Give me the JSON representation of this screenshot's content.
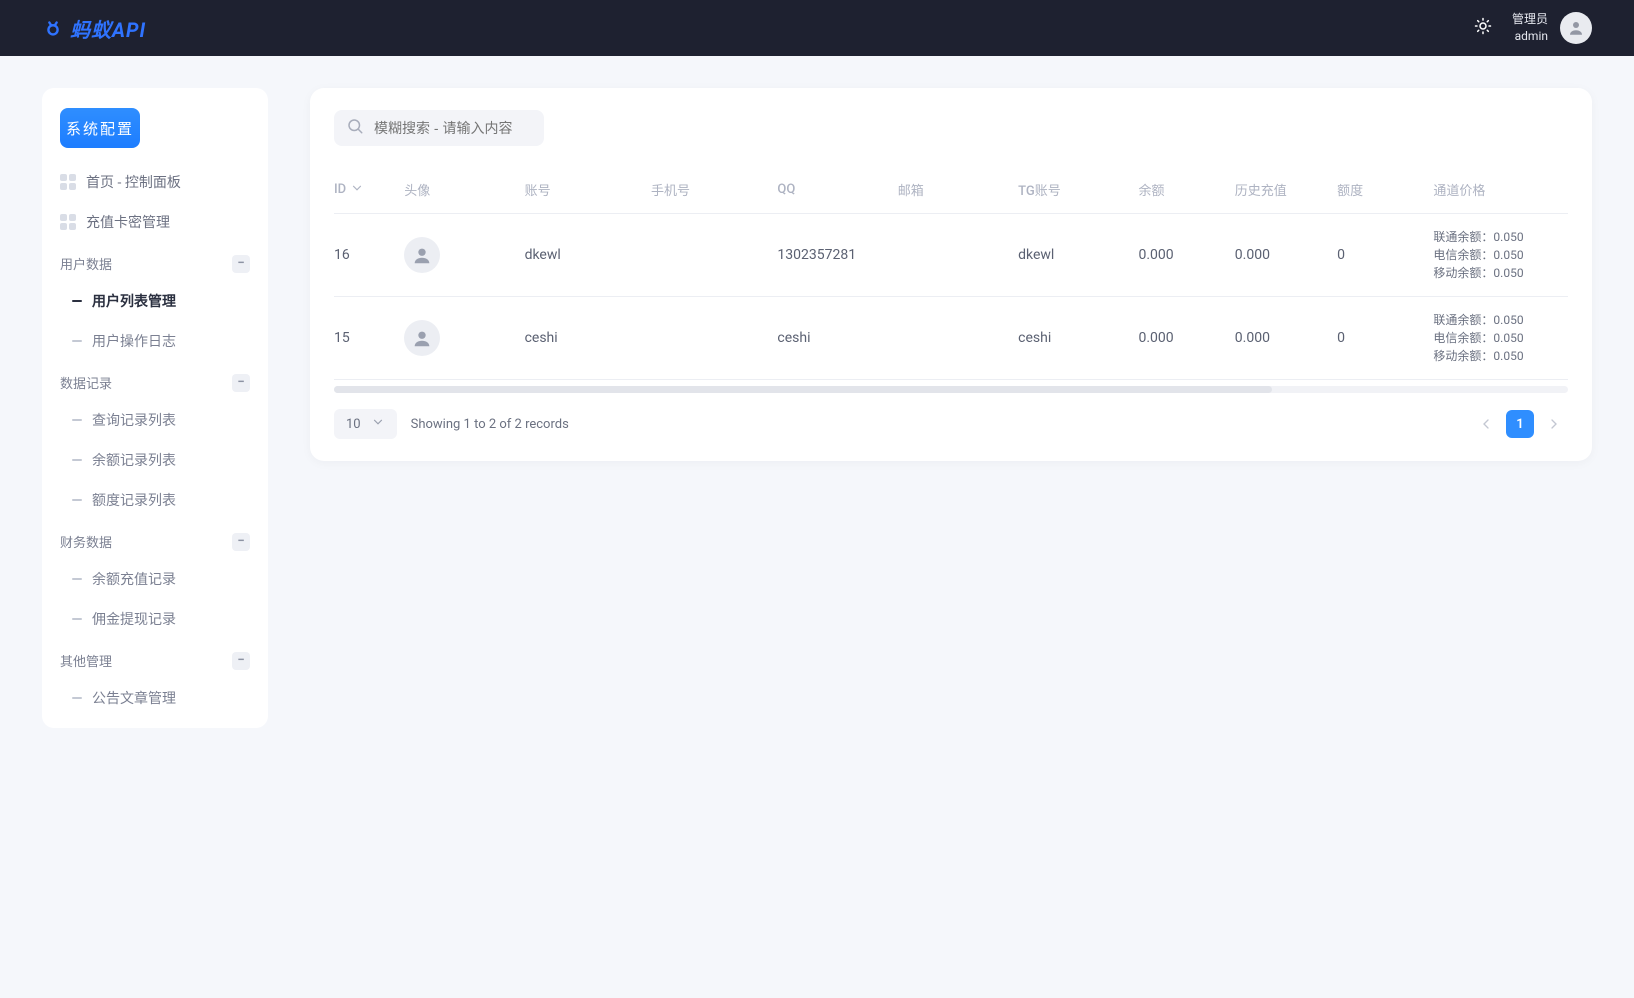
{
  "header": {
    "logo_text": "蚂蚁API",
    "user_role": "管理员",
    "user_name": "admin"
  },
  "sidebar": {
    "config_button": "系统配置",
    "top_items": [
      {
        "label": "首页 - 控制面板"
      },
      {
        "label": "充值卡密管理"
      }
    ],
    "groups": [
      {
        "title": "用户数据",
        "children": [
          {
            "label": "用户列表管理",
            "active": true
          },
          {
            "label": "用户操作日志"
          }
        ]
      },
      {
        "title": "数据记录",
        "children": [
          {
            "label": "查询记录列表"
          },
          {
            "label": "余额记录列表"
          },
          {
            "label": "额度记录列表"
          }
        ]
      },
      {
        "title": "财务数据",
        "children": [
          {
            "label": "余额充值记录"
          },
          {
            "label": "佣金提现记录"
          }
        ]
      },
      {
        "title": "其他管理",
        "children": [
          {
            "label": "公告文章管理"
          }
        ]
      }
    ]
  },
  "main": {
    "search_placeholder": "模糊搜索 - 请输入内容",
    "columns": {
      "id": "ID",
      "avatar": "头像",
      "account": "账号",
      "phone": "手机号",
      "qq": "QQ",
      "email": "邮箱",
      "tg": "TG账号",
      "balance": "余额",
      "history": "历史充值",
      "quota": "额度",
      "price": "通道价格"
    },
    "rows": [
      {
        "id": "16",
        "account": "dkewl",
        "phone": "",
        "qq": "1302357281",
        "email": "",
        "tg": "dkewl",
        "balance": "0.000",
        "history": "0.000",
        "quota": "0",
        "price": {
          "line1": "联通余额：0.050",
          "line2": "电信余额：0.050",
          "line3": "移动余额：0.050"
        }
      },
      {
        "id": "15",
        "account": "ceshi",
        "phone": "",
        "qq": "ceshi",
        "email": "",
        "tg": "ceshi",
        "balance": "0.000",
        "history": "0.000",
        "quota": "0",
        "price": {
          "line1": "联通余额：0.050",
          "line2": "电信余额：0.050",
          "line3": "移动余额：0.050"
        }
      }
    ],
    "footer": {
      "page_size": "10",
      "records_text": "Showing 1 to 2 of 2 records",
      "current_page": "1"
    }
  }
}
